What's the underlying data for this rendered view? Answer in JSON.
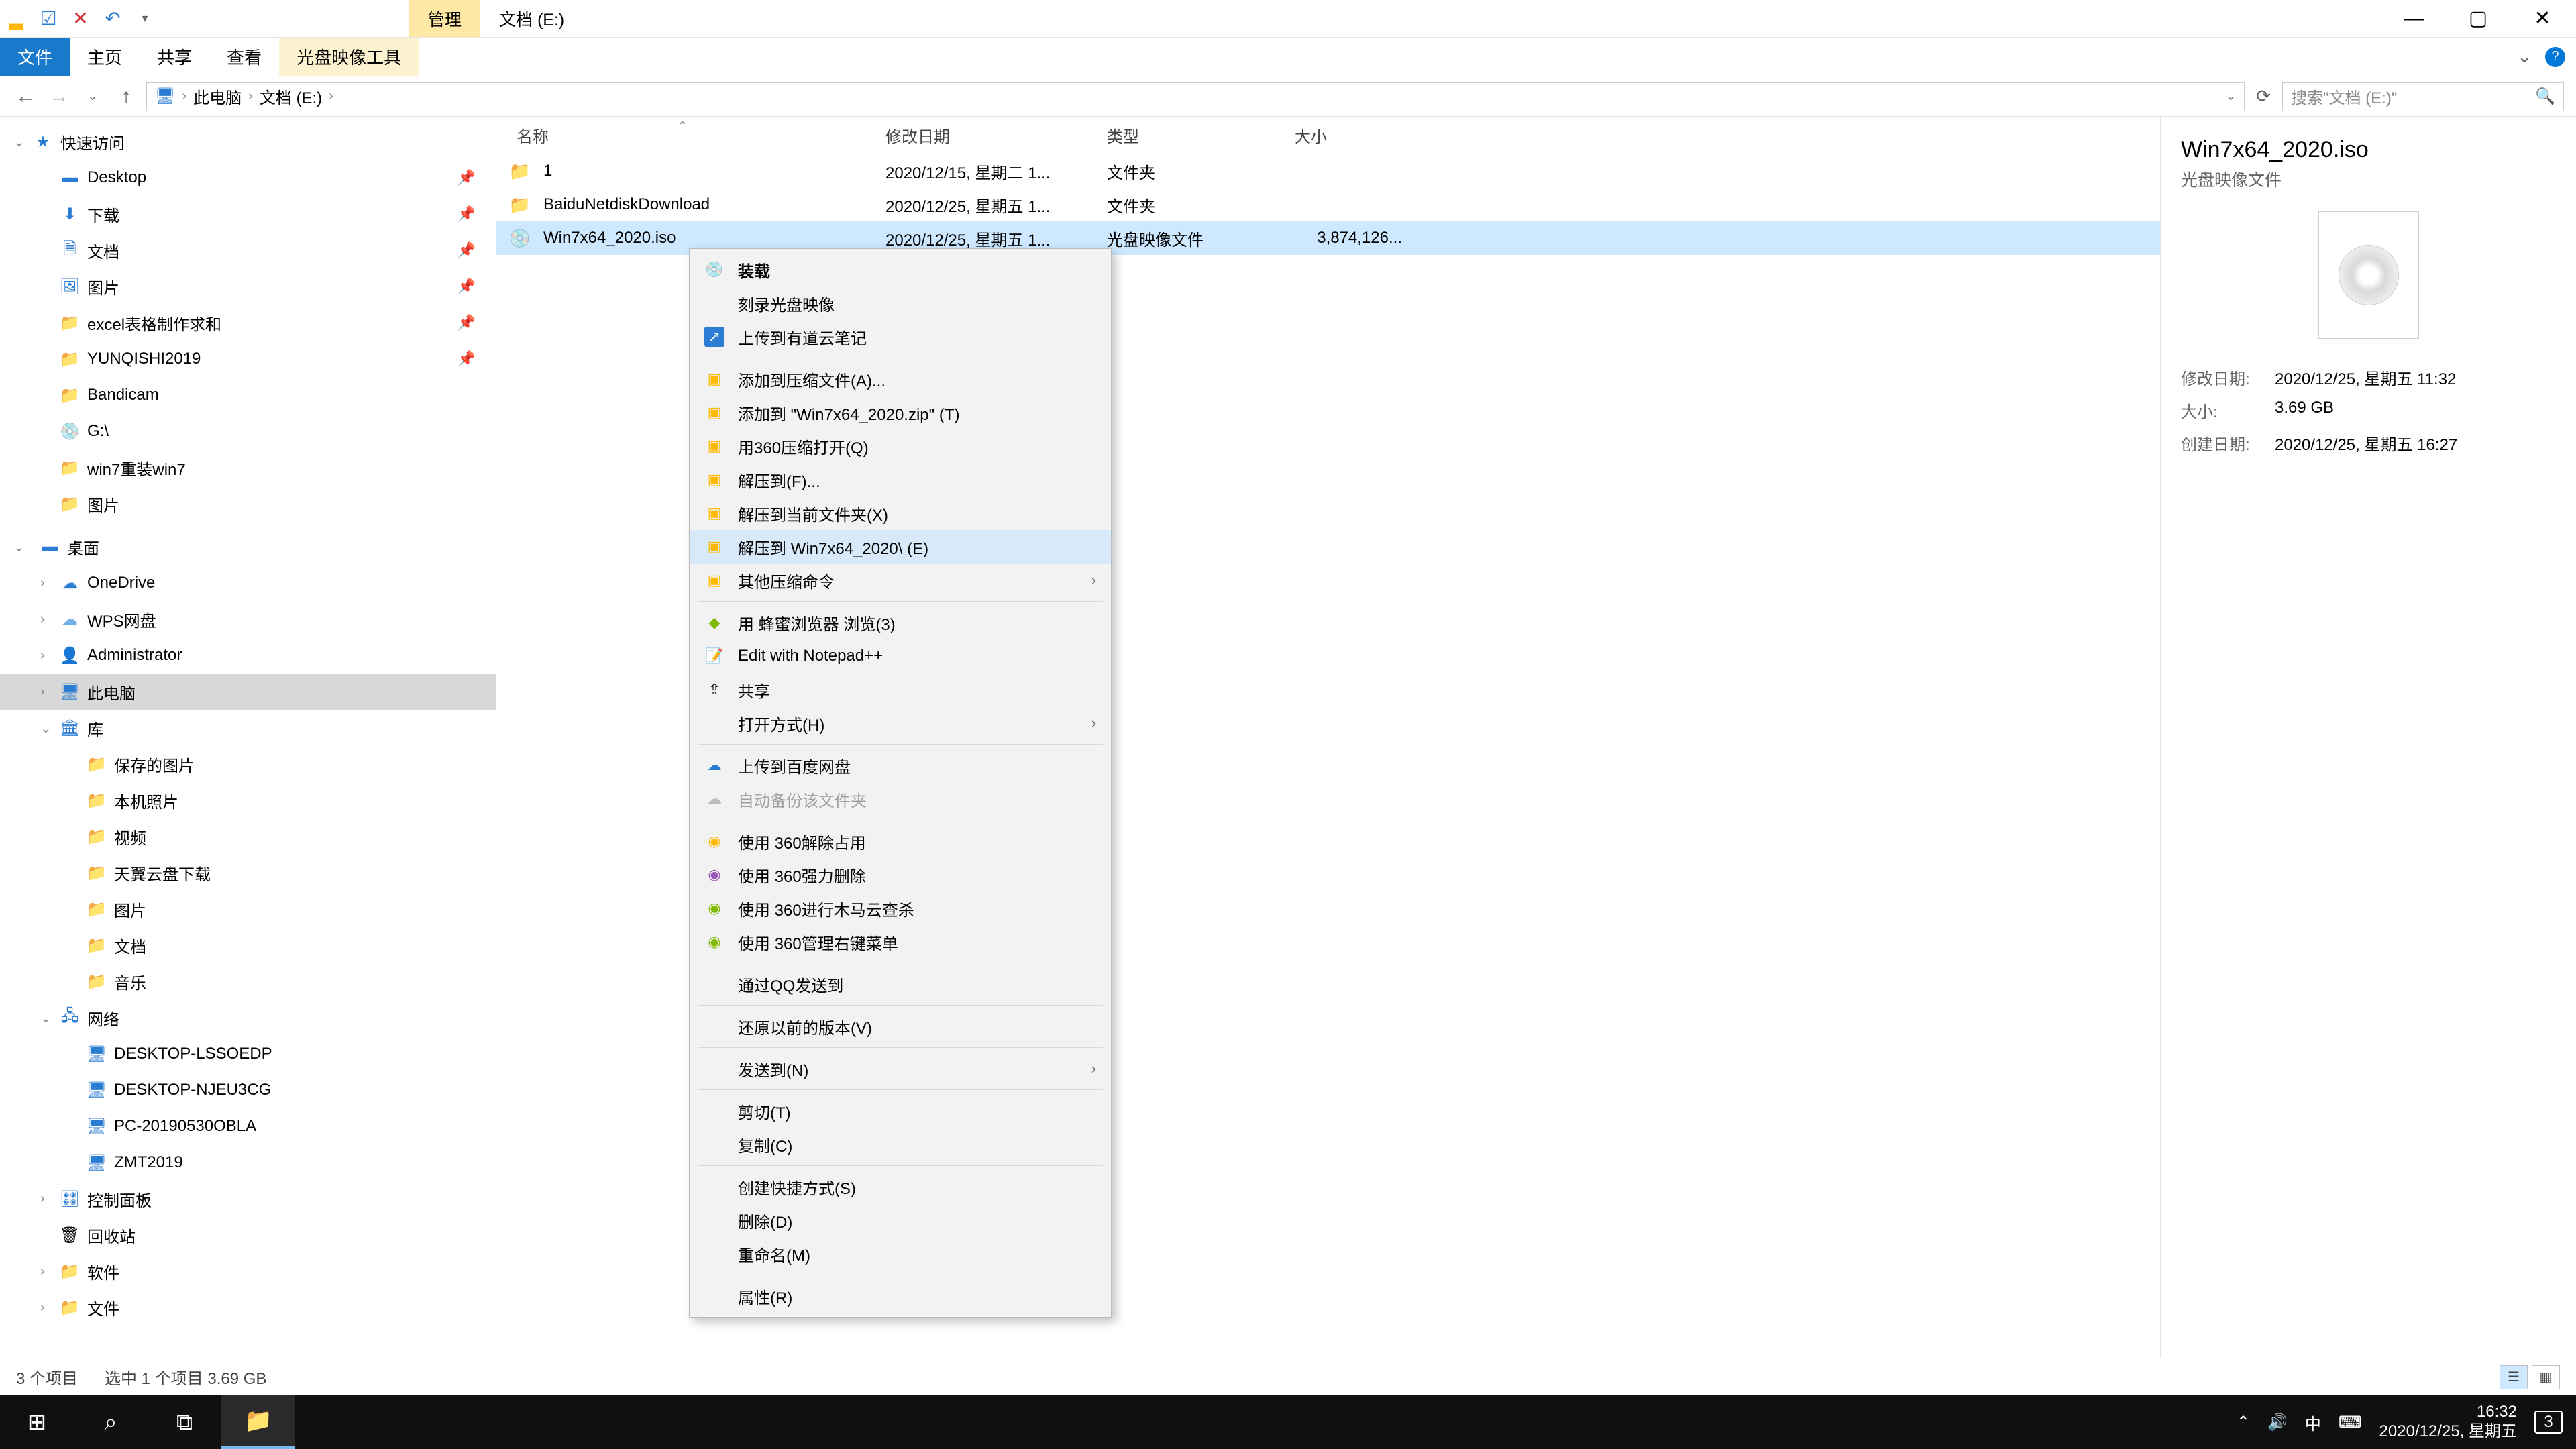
{
  "window": {
    "ctx_tab": "管理",
    "title": "文档 (E:)",
    "ribbon": {
      "file": "文件",
      "home": "主页",
      "share": "共享",
      "view": "查看",
      "ctx": "光盘映像工具"
    }
  },
  "address": {
    "crumbs": [
      "此电脑",
      "文档 (E:)"
    ],
    "search_placeholder": "搜索\"文档 (E:)\""
  },
  "tree": {
    "quick": "快速访问",
    "desktop": "Desktop",
    "downloads": "下载",
    "documents": "文档",
    "pictures": "图片",
    "excel": "excel表格制作求和",
    "yunqishi": "YUNQISHI2019",
    "bandicam": "Bandicam",
    "gdrive": "G:\\",
    "win7redo": "win7重装win7",
    "pictures2": "图片",
    "desk_section": "桌面",
    "onedrive": "OneDrive",
    "wps": "WPS网盘",
    "admin": "Administrator",
    "thispc": "此电脑",
    "libraries": "库",
    "saved_pics": "保存的图片",
    "cam_pics": "本机照片",
    "videos": "视频",
    "tianyi": "天翼云盘下载",
    "pictures3": "图片",
    "docs2": "文档",
    "music": "音乐",
    "network": "网络",
    "pc1": "DESKTOP-LSSOEDP",
    "pc2": "DESKTOP-NJEU3CG",
    "pc3": "PC-20190530OBLA",
    "pc4": "ZMT2019",
    "ctrl_panel": "控制面板",
    "recycle": "回收站",
    "software": "软件",
    "files": "文件"
  },
  "columns": {
    "name": "名称",
    "date": "修改日期",
    "type": "类型",
    "size": "大小"
  },
  "rows": [
    {
      "name": "1",
      "date": "2020/12/15, 星期二 1...",
      "type": "文件夹",
      "size": ""
    },
    {
      "name": "BaiduNetdiskDownload",
      "date": "2020/12/25, 星期五 1...",
      "type": "文件夹",
      "size": ""
    },
    {
      "name": "Win7x64_2020.iso",
      "date": "2020/12/25, 星期五 1...",
      "type": "光盘映像文件",
      "size": "3,874,126..."
    }
  ],
  "context_menu": {
    "mount": "装载",
    "burn": "刻录光盘映像",
    "youdao": "上传到有道云笔记",
    "add_archive": "添加到压缩文件(A)...",
    "add_zip": "添加到 \"Win7x64_2020.zip\" (T)",
    "open_360zip": "用360压缩打开(Q)",
    "extract_to": "解压到(F)...",
    "extract_here": "解压到当前文件夹(X)",
    "extract_named": "解压到 Win7x64_2020\\ (E)",
    "other_zip": "其他压缩命令",
    "bee": "用 蜂蜜浏览器 浏览(3)",
    "npp": "Edit with Notepad++",
    "share": "共享",
    "open_with": "打开方式(H)",
    "baidu_upload": "上传到百度网盘",
    "auto_backup": "自动备份该文件夹",
    "unlock360": "使用 360解除占用",
    "force_del360": "使用 360强力删除",
    "trojan360": "使用 360进行木马云查杀",
    "menu360": "使用 360管理右键菜单",
    "qq_send": "通过QQ发送到",
    "restore_prev": "还原以前的版本(V)",
    "send_to": "发送到(N)",
    "cut": "剪切(T)",
    "copy": "复制(C)",
    "shortcut": "创建快捷方式(S)",
    "delete": "删除(D)",
    "rename": "重命名(M)",
    "props": "属性(R)"
  },
  "details": {
    "title": "Win7x64_2020.iso",
    "subtitle": "光盘映像文件",
    "mod_k": "修改日期:",
    "mod_v": "2020/12/25, 星期五 11:32",
    "size_k": "大小:",
    "size_v": "3.69 GB",
    "create_k": "创建日期:",
    "create_v": "2020/12/25, 星期五 16:27"
  },
  "status": {
    "count": "3 个项目",
    "selected": "选中 1 个项目  3.69 GB"
  },
  "taskbar": {
    "ime": "中",
    "time": "16:32",
    "date": "2020/12/25, 星期五",
    "notif": "3"
  }
}
